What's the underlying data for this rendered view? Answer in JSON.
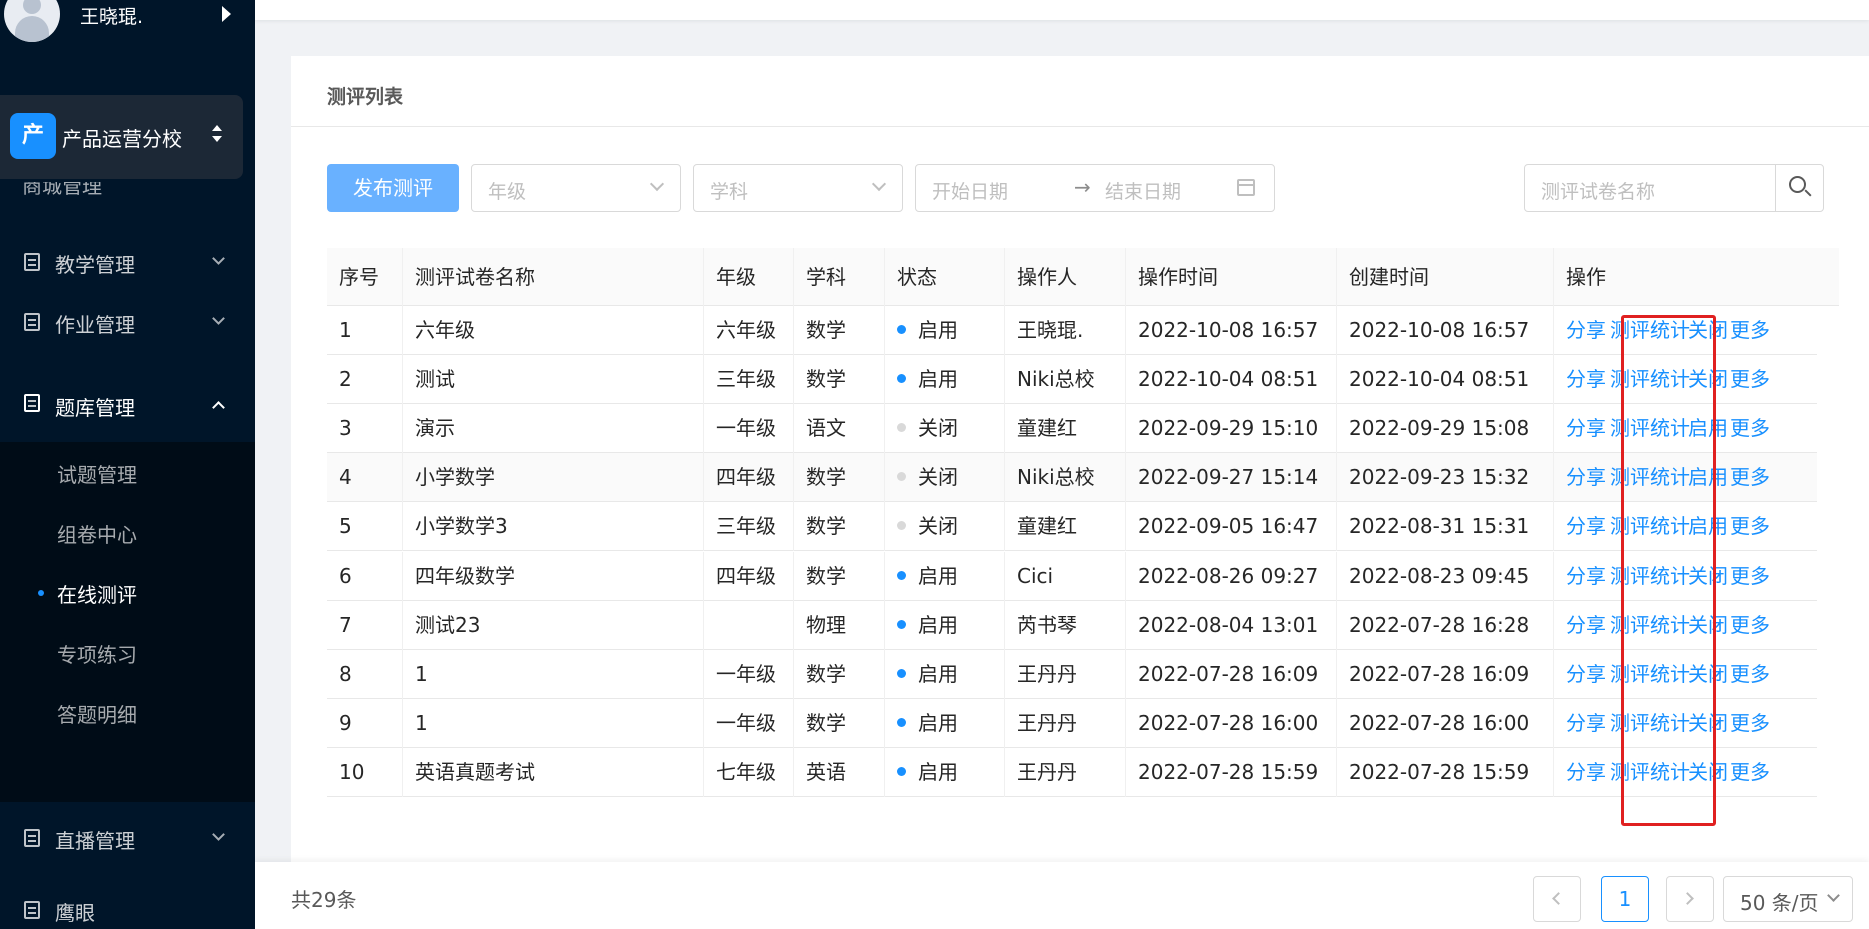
{
  "user": {
    "name": "王晓琨."
  },
  "school": {
    "badge": "产",
    "name": "产品运营分校"
  },
  "sidebar": {
    "partial_item": "商城管理",
    "items": [
      {
        "label": "教学管理"
      },
      {
        "label": "作业管理"
      },
      {
        "label": "题库管理"
      },
      {
        "label": "直播管理"
      },
      {
        "label": "鹰眼"
      }
    ],
    "subitems": [
      {
        "label": "试题管理"
      },
      {
        "label": "组卷中心"
      },
      {
        "label": "在线测评"
      },
      {
        "label": "专项练习"
      },
      {
        "label": "答题明细"
      }
    ]
  },
  "card": {
    "title": "测评列表"
  },
  "toolbar": {
    "publish_label": "发布测评",
    "grade_placeholder": "年级",
    "subject_placeholder": "学科",
    "start_placeholder": "开始日期",
    "range_arrow": "→",
    "end_placeholder": "结束日期",
    "search_placeholder": "测评试卷名称"
  },
  "table": {
    "headers": [
      "序号",
      "测评试卷名称",
      "年级",
      "学科",
      "状态",
      "操作人",
      "操作时间",
      "创建时间",
      "操作"
    ],
    "actions": {
      "share": "分享",
      "stats": "测评统计",
      "more": "更多"
    },
    "rows": [
      {
        "no": "1",
        "name": "六年级",
        "grade": "六年级",
        "subject": "数学",
        "status": "启用",
        "operator": "王晓琨.",
        "op_time": "2022-10-08 16:57",
        "created": "2022-10-08 16:57",
        "toggle": "关闭"
      },
      {
        "no": "2",
        "name": "测试",
        "grade": "三年级",
        "subject": "数学",
        "status": "启用",
        "operator": "Niki总校",
        "op_time": "2022-10-04 08:51",
        "created": "2022-10-04 08:51",
        "toggle": "关闭"
      },
      {
        "no": "3",
        "name": "演示",
        "grade": "一年级",
        "subject": "语文",
        "status": "关闭",
        "operator": "童建红",
        "op_time": "2022-09-29 15:10",
        "created": "2022-09-29 15:08",
        "toggle": "启用"
      },
      {
        "no": "4",
        "name": "小学数学",
        "grade": "四年级",
        "subject": "数学",
        "status": "关闭",
        "operator": "Niki总校",
        "op_time": "2022-09-27 15:14",
        "created": "2022-09-23 15:32",
        "toggle": "启用"
      },
      {
        "no": "5",
        "name": "小学数学3",
        "grade": "三年级",
        "subject": "数学",
        "status": "关闭",
        "operator": "童建红",
        "op_time": "2022-09-05 16:47",
        "created": "2022-08-31 15:31",
        "toggle": "启用"
      },
      {
        "no": "6",
        "name": "四年级数学",
        "grade": "四年级",
        "subject": "数学",
        "status": "启用",
        "operator": "Cici",
        "op_time": "2022-08-26 09:27",
        "created": "2022-08-23 09:45",
        "toggle": "关闭"
      },
      {
        "no": "7",
        "name": "测试23",
        "grade": "",
        "subject": "物理",
        "status": "启用",
        "operator": "芮书琴",
        "op_time": "2022-08-04 13:01",
        "created": "2022-07-28 16:28",
        "toggle": "关闭"
      },
      {
        "no": "8",
        "name": "1",
        "grade": "一年级",
        "subject": "数学",
        "status": "启用",
        "operator": "王丹丹",
        "op_time": "2022-07-28 16:09",
        "created": "2022-07-28 16:09",
        "toggle": "关闭"
      },
      {
        "no": "9",
        "name": "1",
        "grade": "一年级",
        "subject": "数学",
        "status": "启用",
        "operator": "王丹丹",
        "op_time": "2022-07-28 16:00",
        "created": "2022-07-28 16:00",
        "toggle": "关闭"
      },
      {
        "no": "10",
        "name": "英语真题考试",
        "grade": "七年级",
        "subject": "英语",
        "status": "启用",
        "operator": "王丹丹",
        "op_time": "2022-07-28 15:59",
        "created": "2022-07-28 15:59",
        "toggle": "关闭"
      }
    ]
  },
  "pagination": {
    "total": "共29条",
    "current": "1",
    "page_size": "50 条/页"
  },
  "colors": {
    "accent": "#1890ff",
    "sidebar": "#001529",
    "enabled": "#1890ff",
    "disabled": "#d9d9d9",
    "highlight": "#e02020"
  }
}
